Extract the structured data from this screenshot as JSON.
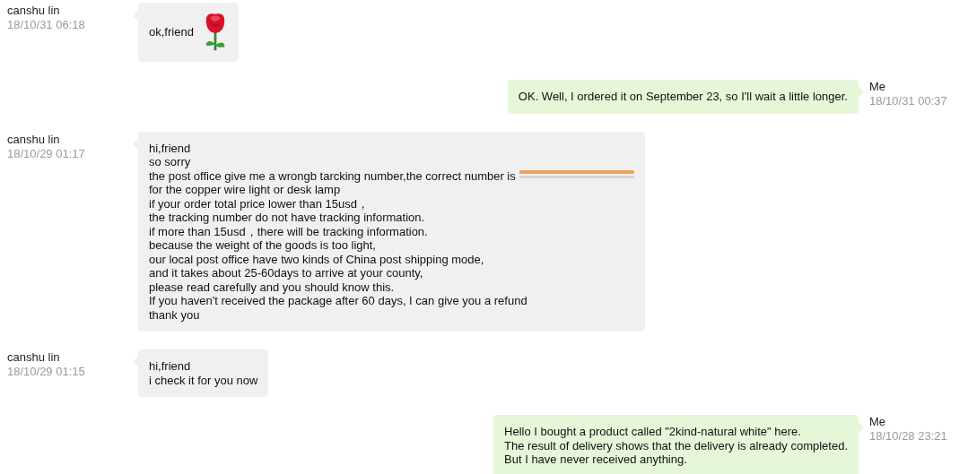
{
  "messages": [
    {
      "sender": "canshu lin",
      "time": "18/10/31 06:18",
      "outgoing": false,
      "lines": [
        {
          "text": "ok,friend",
          "redacted": false
        }
      ],
      "sticker": true
    },
    {
      "sender": "Me",
      "time": "18/10/31 00:37",
      "outgoing": true,
      "lines": [
        {
          "text": "OK. Well, I ordered it on September 23, so I'll wait a little longer.",
          "redacted": false
        }
      ],
      "sticker": false
    },
    {
      "sender": "canshu lin",
      "time": "18/10/29 01:17",
      "outgoing": false,
      "sticker": false,
      "lines": [
        {
          "text": "hi,friend",
          "redacted": false
        },
        {
          "text": "so sorry",
          "redacted": false
        },
        {
          "text": "the post office give me a wrongb tarcking number,the correct number is",
          "redacted": true
        },
        {
          "text": "for the copper wire light or desk lamp",
          "redacted": false
        },
        {
          "text": "if your order total price lower than 15usd，",
          "redacted": false
        },
        {
          "text": "the tracking number do not have tracking information.",
          "redacted": false
        },
        {
          "text": "if more than 15usd，there will be tracking information.",
          "redacted": false
        },
        {
          "text": "because the weight of the goods is too light,",
          "redacted": false
        },
        {
          "text": "our local post office have two kinds of China post shipping mode,",
          "redacted": false
        },
        {
          "text": "and it takes about 25-60days to arrive at your county,",
          "redacted": false
        },
        {
          "text": "please read carefully and you should know this.",
          "redacted": false
        },
        {
          "text": "If you haven't received the package after 60 days, I can give you a refund",
          "redacted": false
        },
        {
          "text": "thank you",
          "redacted": false
        }
      ]
    },
    {
      "sender": "canshu lin",
      "time": "18/10/29 01:15",
      "outgoing": false,
      "sticker": false,
      "lines": [
        {
          "text": "hi,friend",
          "redacted": false
        },
        {
          "text": "i check it for you now",
          "redacted": false
        }
      ]
    },
    {
      "sender": "Me",
      "time": "18/10/28 23:21",
      "outgoing": true,
      "sticker": false,
      "lines": [
        {
          "text": "Hello I bought a product called \"2kind-natural white\" here.",
          "redacted": false
        },
        {
          "text": "The result of delivery shows that the delivery is already completed.",
          "redacted": false
        },
        {
          "text": "But I have never received anything.",
          "redacted": false
        }
      ]
    }
  ]
}
